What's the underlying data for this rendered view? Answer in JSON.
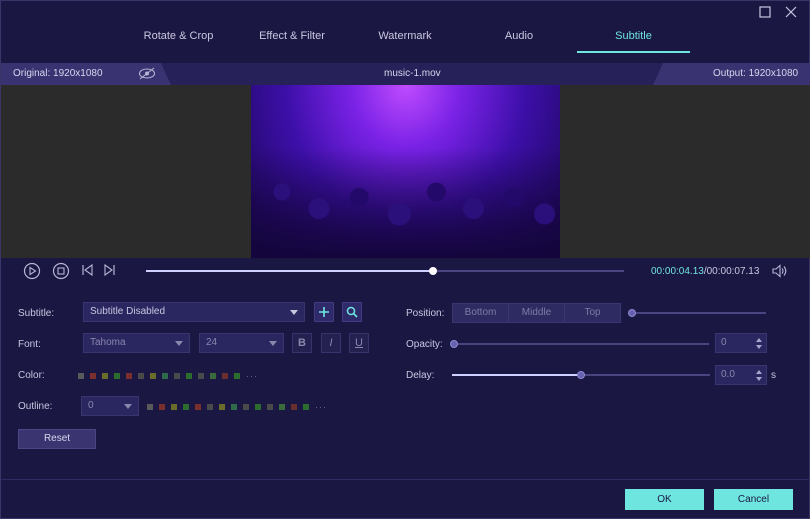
{
  "tabs": [
    "Rotate & Crop",
    "Effect & Filter",
    "Watermark",
    "Audio",
    "Subtitle"
  ],
  "active_tab": "Subtitle",
  "infobar": {
    "original": "Original: 1920x1080",
    "filename": "music-1.mov",
    "output": "Output: 1920x1080"
  },
  "playback": {
    "current": "00:00:04.13",
    "total": "/00:00:07.13",
    "progress": 0.6
  },
  "subtitle": {
    "label": "Subtitle:",
    "value": "Subtitle Disabled"
  },
  "font": {
    "label": "Font:",
    "family": "Tahoma",
    "size": "24",
    "bold": "B",
    "italic": "I",
    "underline": "U"
  },
  "color": {
    "label": "Color:"
  },
  "outline": {
    "label": "Outline:",
    "value": "0"
  },
  "reset_label": "Reset",
  "position": {
    "label": "Position:",
    "options": [
      "Bottom",
      "Middle",
      "Top"
    ]
  },
  "opacity": {
    "label": "Opacity:",
    "value": "0",
    "level": 0
  },
  "delay": {
    "label": "Delay:",
    "value": "0.0",
    "unit": "s",
    "level": 0.5
  },
  "ok_label": "OK",
  "cancel_label": "Cancel",
  "colors": {
    "accent": "#6ee6df",
    "background": "#1b1743"
  },
  "swatch_colors": [
    "#5a5a5a",
    "#7a2e2e",
    "#6b6b2a",
    "#2e6b2e",
    "#7a2e2e",
    "#4a4a4a",
    "#6b6b2a",
    "#2e6b4a",
    "#4a4a4a",
    "#2e6b2e",
    "#4a4a4a",
    "#3a6b3a",
    "#6b2e2e",
    "#2e6b2e"
  ]
}
